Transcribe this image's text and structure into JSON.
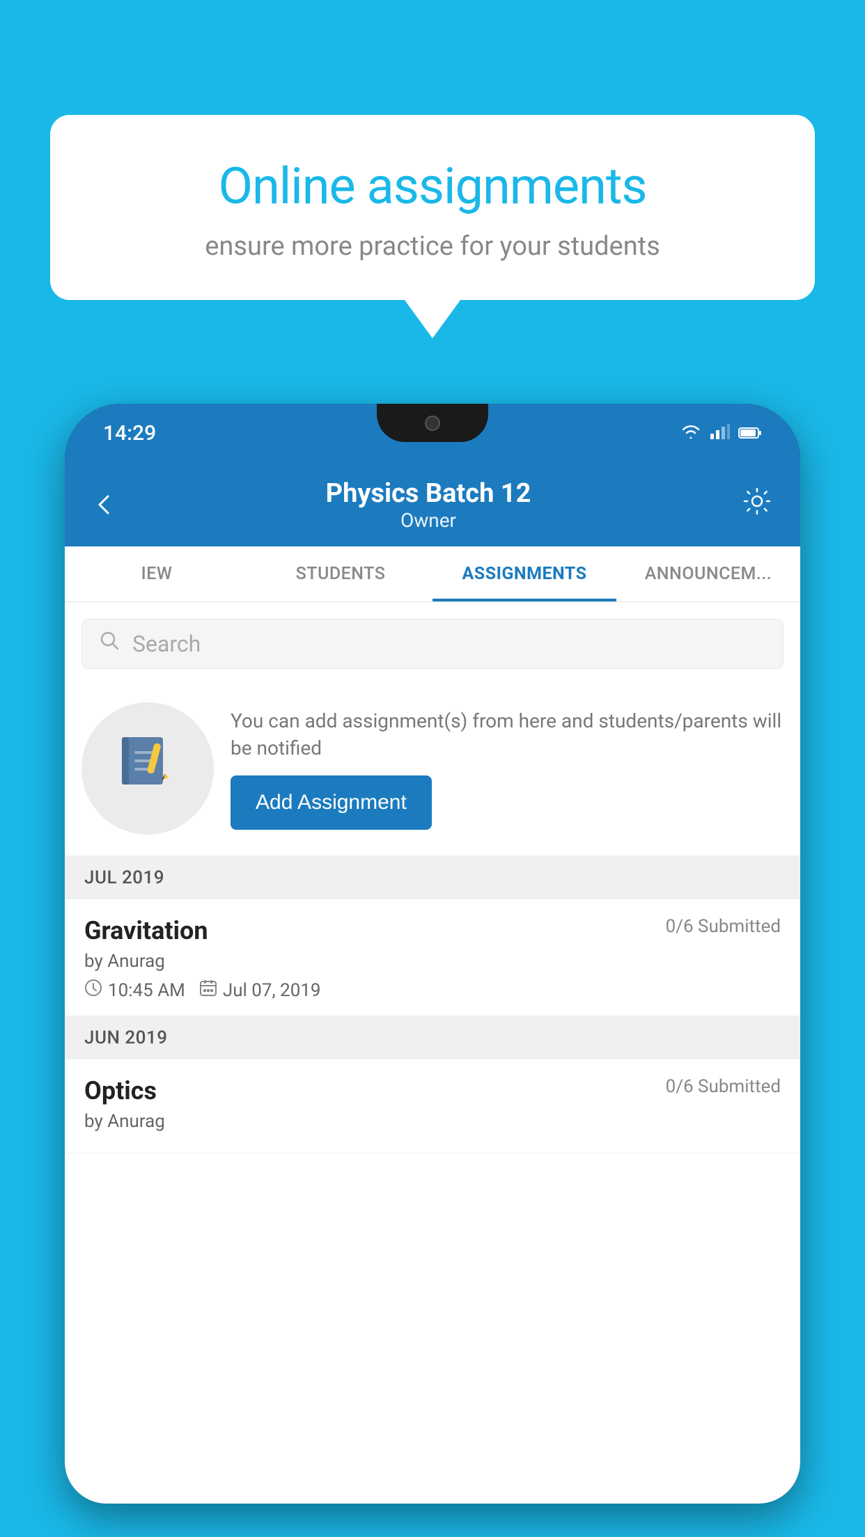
{
  "background_color": "#1ab8e8",
  "speech_bubble": {
    "title": "Online assignments",
    "subtitle": "ensure more practice for your students"
  },
  "phone": {
    "status_bar": {
      "time": "14:29"
    },
    "header": {
      "title": "Physics Batch 12",
      "subtitle": "Owner",
      "back_label": "←",
      "settings_label": "⚙"
    },
    "tabs": [
      {
        "label": "IEW",
        "active": false
      },
      {
        "label": "STUDENTS",
        "active": false
      },
      {
        "label": "ASSIGNMENTS",
        "active": true
      },
      {
        "label": "ANNOUNCEM...",
        "active": false
      }
    ],
    "search": {
      "placeholder": "Search"
    },
    "add_assignment_section": {
      "description": "You can add assignment(s) from here and students/parents will be notified",
      "button_label": "Add Assignment"
    },
    "sections": [
      {
        "month_label": "JUL 2019",
        "assignments": [
          {
            "name": "Gravitation",
            "submitted": "0/6 Submitted",
            "author": "by Anurag",
            "time": "10:45 AM",
            "date": "Jul 07, 2019"
          }
        ]
      },
      {
        "month_label": "JUN 2019",
        "assignments": [
          {
            "name": "Optics",
            "submitted": "0/6 Submitted",
            "author": "by Anurag",
            "time": "",
            "date": ""
          }
        ]
      }
    ]
  }
}
